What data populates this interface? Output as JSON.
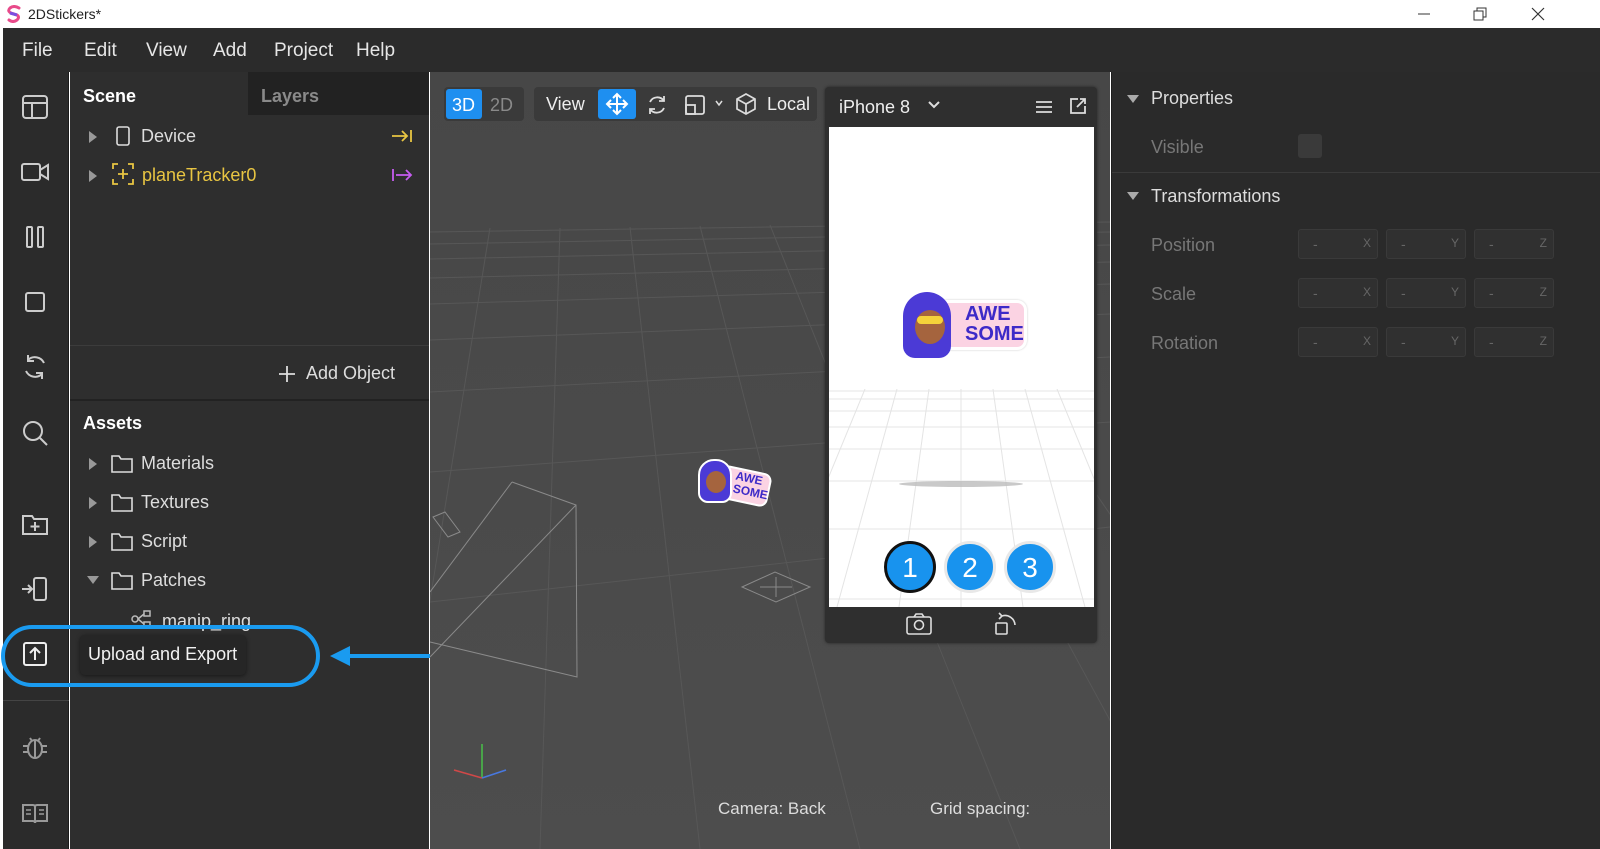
{
  "window": {
    "title": "2DStickers*"
  },
  "menu": [
    "File",
    "Edit",
    "View",
    "Add",
    "Project",
    "Help"
  ],
  "sidebar": {
    "tooltip": "Upload and Export",
    "icons": [
      "layout-icon",
      "camera-icon",
      "pause-icon",
      "square-icon",
      "refresh-icon",
      "search-icon",
      "add-folder-icon",
      "import-device-icon",
      "upload-export-icon",
      "bug-icon",
      "book-icon"
    ]
  },
  "scene": {
    "tabs": [
      "Scene",
      "Layers"
    ],
    "items": [
      {
        "label": "Device"
      },
      {
        "label": "planeTracker0"
      }
    ],
    "add_object": "Add Object"
  },
  "assets": {
    "title": "Assets",
    "items": [
      "Materials",
      "Textures",
      "Script",
      "Patches"
    ],
    "child": "manip_ring"
  },
  "viewport": {
    "mode_3d": "3D",
    "mode_2d": "2D",
    "view": "View",
    "local": "Local",
    "device": "iPhone 8",
    "sticker_text_1": "AWE",
    "sticker_text_2": "SOME",
    "buttons": [
      "1",
      "2",
      "3"
    ],
    "camera_status": "Camera: Back",
    "grid_spacing": "Grid spacing:"
  },
  "properties": {
    "title": "Properties",
    "visible_label": "Visible",
    "transformations_title": "Transformations",
    "rows": [
      {
        "label": "Position"
      },
      {
        "label": "Scale"
      },
      {
        "label": "Rotation"
      }
    ],
    "placeholder": "-",
    "axes": [
      "X",
      "Y",
      "Z"
    ]
  },
  "colors": {
    "accent": "#1e8ff0",
    "highlight": "#e8c542",
    "tracker": "#c65cf0",
    "annotation": "#1a9bf0"
  }
}
